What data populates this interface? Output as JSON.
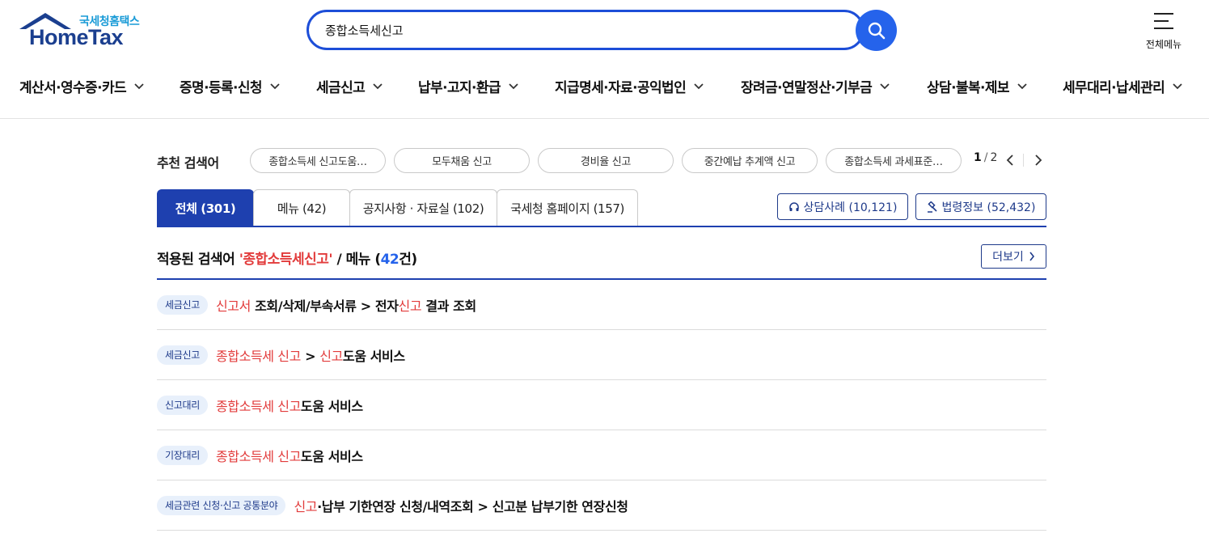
{
  "header": {
    "logo_sub": "국세청홈택스",
    "logo_main": "HomeTax",
    "search_value": "종합소득세신고",
    "allmenu_label": "전체메뉴"
  },
  "gnb": [
    {
      "label": "계산서·영수증·카드"
    },
    {
      "label": "증명·등록·신청"
    },
    {
      "label": "세금신고"
    },
    {
      "label": "납부·고지·환급"
    },
    {
      "label": "지급명세·자료·공익법인"
    },
    {
      "label": "장려금·연말정산·기부금"
    },
    {
      "label": "상담·불복·제보"
    },
    {
      "label": "세무대리·납세관리"
    }
  ],
  "recommend": {
    "label": "추천 검색어",
    "chips": [
      "종합소득세 신고도움…",
      "모두채움 신고",
      "경비율 신고",
      "중간예납 추계액 신고",
      "종합소득세 과세표준…"
    ],
    "page_current": "1",
    "page_total": "2"
  },
  "tabs": [
    {
      "label": "전체 (301)",
      "active": true
    },
    {
      "label": "메뉴 (42)"
    },
    {
      "label": "공지사항 · 자료실 (102)"
    },
    {
      "label": "국세청 홈페이지 (157)"
    }
  ],
  "side_buttons": {
    "consult": "상담사례 (10,121)",
    "law": "법령정보 (52,432)"
  },
  "section": {
    "prefix": "적용된 검색어 ",
    "query": "'종합소득세신고'",
    "middle": " / 메뉴 (",
    "count": "42",
    "suffix": "건)",
    "more_label": "더보기"
  },
  "results": [
    {
      "badge": "세금신고",
      "parts": [
        {
          "t": "신고서",
          "hl": true
        },
        {
          "t": " 조회/삭제/부속서류 > 전자"
        },
        {
          "t": "신고",
          "hl": true
        },
        {
          "t": " 결과 조회"
        }
      ]
    },
    {
      "badge": "세금신고",
      "parts": [
        {
          "t": "종합소득세 신고",
          "hl": true
        },
        {
          "t": " > "
        },
        {
          "t": "신고",
          "hl": true
        },
        {
          "t": "도움 서비스"
        }
      ]
    },
    {
      "badge": "신고대리",
      "parts": [
        {
          "t": "종합소득세 신고",
          "hl": true
        },
        {
          "t": "도움 서비스"
        }
      ]
    },
    {
      "badge": "기장대리",
      "parts": [
        {
          "t": "종합소득세 신고",
          "hl": true
        },
        {
          "t": "도움 서비스"
        }
      ]
    },
    {
      "badge": "세금관련 신청·신고 공통분야",
      "parts": [
        {
          "t": "신고",
          "hl": true
        },
        {
          "t": "·납부 기한연장 신청/내역조회 > 신고분 납부기한 연장신청"
        }
      ]
    }
  ],
  "colors": {
    "primary": "#1e40af",
    "search_blue": "#2563eb",
    "highlight_red": "#e23b3b",
    "logo_navy": "#1b3f8f",
    "logo_cyan": "#1a9bd7"
  }
}
